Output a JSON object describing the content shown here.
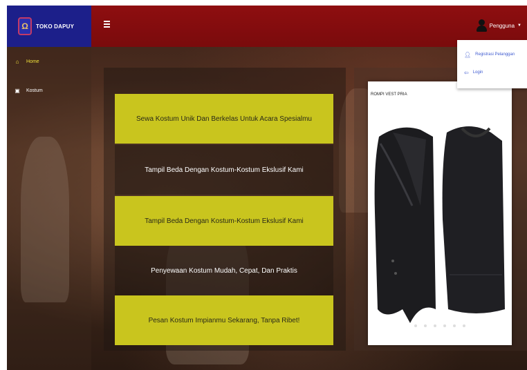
{
  "brand": {
    "name": "TOKO DAPUY"
  },
  "header": {
    "user_label": "Pengguna"
  },
  "user_dropdown": {
    "items": [
      {
        "label": "Registrasi Pelanggan",
        "icon": "user-icon"
      },
      {
        "label": "Login",
        "icon": "login-icon"
      }
    ]
  },
  "sidebar": {
    "items": [
      {
        "label": "Home",
        "icon": "home-icon",
        "active": true
      },
      {
        "label": "Kostum",
        "icon": "costume-icon",
        "active": false
      }
    ]
  },
  "main": {
    "slogans": [
      "Sewa Kostum Unik Dan Berkelas Untuk Acara Spesialmu",
      "Tampil Beda Dengan Kostum-Kostum Ekslusif Kami",
      "Tampil Beda Dengan Kostum-Kostum Ekslusif Kami",
      "Penyewaan Kostum Mudah, Cepat, Dan Praktis",
      "Pesan Kostum Impianmu Sekarang, Tanpa Ribet!"
    ]
  },
  "product_card": {
    "title": "ROMPI VEST PRIA"
  },
  "colors": {
    "brand_bg": "#1c1f8a",
    "topbar_bg": "#8e0e10",
    "accent_yellow": "#c9c51e",
    "link_blue": "#3f5bd0"
  }
}
